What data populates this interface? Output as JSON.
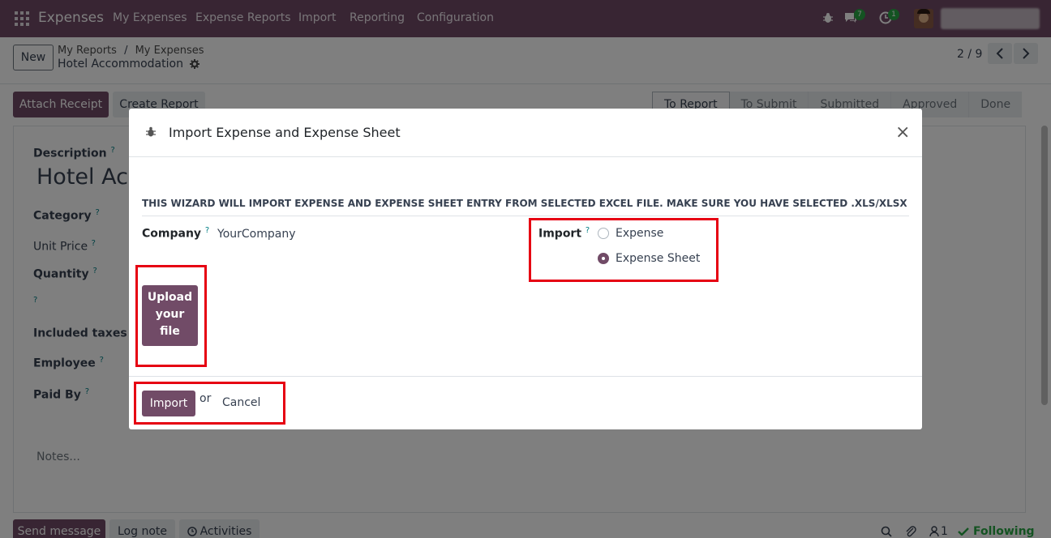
{
  "navbar": {
    "app_name": "Expenses",
    "menu": [
      "My Expenses",
      "Expense Reports",
      "Import",
      "Reporting",
      "Configuration"
    ],
    "messages_count": "7",
    "activities_count": "1",
    "icons": [
      "apps-grid-icon",
      "bug-icon",
      "chat-icon",
      "clock-icon"
    ]
  },
  "control_panel": {
    "new_label": "New",
    "breadcrumb": [
      "My Reports",
      "My Expenses"
    ],
    "breadcrumb_separator": "/",
    "current_record": "Hotel Accommodation",
    "pager": "2 / 9"
  },
  "actions": {
    "attach_receipt": "Attach Receipt",
    "create_report": "Create Report"
  },
  "statusbar": [
    "To Report",
    "To Submit",
    "Submitted",
    "Approved",
    "Done"
  ],
  "form_bg": {
    "description_label": "Description",
    "title": "Hotel Acc",
    "category_label": "Category",
    "unit_price_label": "Unit Price",
    "quantity_label": "Quantity",
    "included_taxes_label": "Included taxes",
    "employee_label": "Employee",
    "paid_by_label": "Paid By",
    "help_mark": "?",
    "notes_placeholder": "Notes..."
  },
  "chatter": {
    "send_message": "Send message",
    "log_note": "Log note",
    "activities": "Activities",
    "followers_count": "1",
    "following": "Following"
  },
  "modal": {
    "title": "Import Expense and Expense Sheet",
    "close_glyph": "×",
    "wizard_note": "THIS WIZARD WILL IMPORT EXPENSE AND EXPENSE SHEET ENTRY FROM SELECTED EXCEL FILE. MAKE SURE YOU HAVE SELECTED .XLS/XLSX FILE...",
    "company_label": "Company",
    "company_value": "YourCompany",
    "import_label": "Import",
    "help_mark": "?",
    "import_options": [
      "Expense",
      "Expense Sheet"
    ],
    "selected_option": "Expense Sheet",
    "upload_label_lines": [
      "Upload",
      "your",
      "file"
    ],
    "import_button": "Import",
    "or_text": "or",
    "cancel_link": "Cancel"
  },
  "colors": {
    "brand": "#714b67",
    "highlight": "#e60012",
    "help": "#017e84",
    "badge": "#28a745"
  }
}
